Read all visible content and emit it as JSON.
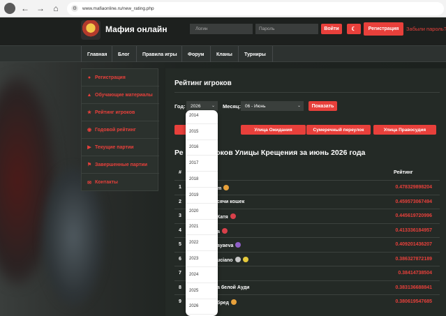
{
  "browser": {
    "url": "www.mafiaonline.ru/new_rating.php"
  },
  "header": {
    "site_title": "Мафия онлайн",
    "login_placeholder": "Логин",
    "password_placeholder": "Пароль",
    "login_button": "Войти",
    "register_button": "Регистрация",
    "forgot_link": "Забыли пароль?"
  },
  "nav": {
    "items": [
      "Главная",
      "Блог",
      "Правила игры",
      "Форум",
      "Кланы",
      "Турниры"
    ]
  },
  "sidebar": {
    "items": [
      {
        "label": "Регистрация",
        "icon": "user-plus-icon"
      },
      {
        "label": "Обучающие материалы",
        "icon": "graduation-cap-icon"
      },
      {
        "label": "Рейтинг игроков",
        "icon": "trophy-icon"
      },
      {
        "label": "Годовой рейтинг",
        "icon": "award-icon"
      },
      {
        "label": "Текущие партии",
        "icon": "play-circle-icon"
      },
      {
        "label": "Завершенные партии",
        "icon": "flag-icon"
      },
      {
        "label": "Контакты",
        "icon": "envelope-icon"
      }
    ]
  },
  "main": {
    "title": "Рейтинг игроков",
    "year_label": "Год:",
    "year_value": "2026",
    "month_label": "Месяц:",
    "month_value": "06 - Июнь",
    "show_button": "Показать",
    "streets": [
      "Улица Ожидания",
      "Сумеречный переулок",
      "Улица Правосудия"
    ],
    "ranking_title": "Рейтинг игроков Улицы Крещения за июнь 2026 года",
    "ranking_title_visible": "Ре                оков Улицы Крещения за июнь 2026 года",
    "col_num": "#",
    "col_rating": "Рейтинг",
    "rows": [
      {
        "num": "1",
        "name": "m",
        "value": "0.478329898204"
      },
      {
        "num": "2",
        "name": "сячи кошек",
        "value": "0.459573067494"
      },
      {
        "num": "3",
        "name": "Катя",
        "value": "0.445619720996"
      },
      {
        "num": "4",
        "name": "а",
        "value": "0.413336184957"
      },
      {
        "num": "5",
        "name": "ayaeva",
        "value": "0.409201436207"
      },
      {
        "num": "6",
        "name": "uciano",
        "value": "0.386327872189"
      },
      {
        "num": "7",
        "name": "",
        "value": "0.38414738504"
      },
      {
        "num": "8",
        "name": "а белой Ауди",
        "value": "0.383136688841"
      },
      {
        "num": "9",
        "name": "бред",
        "value": "0.380619547685"
      }
    ]
  },
  "year_dropdown": {
    "options": [
      "2014",
      "2015",
      "2016",
      "2017",
      "2018",
      "2019",
      "2020",
      "2021",
      "2022",
      "2023",
      "2024",
      "2025",
      "2026"
    ]
  },
  "colors": {
    "accent": "#e8403b",
    "panel": "#242a26",
    "header": "#1d201e"
  }
}
